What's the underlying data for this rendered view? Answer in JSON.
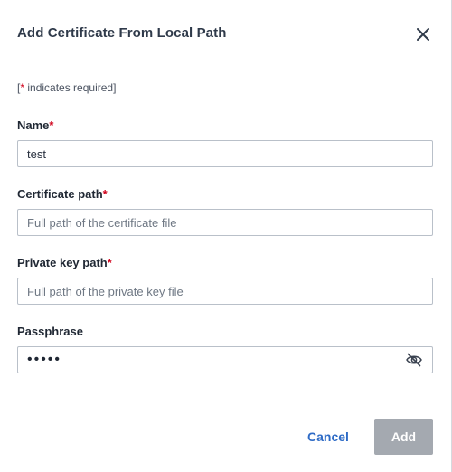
{
  "dialog": {
    "title": "Add Certificate From Local Path",
    "close_icon": "close-icon",
    "required_note_prefix": "[",
    "required_note_star": "*",
    "required_note_suffix": " indicates required]"
  },
  "fields": {
    "name": {
      "label": "Name",
      "required_mark": "*",
      "value": "test",
      "placeholder": ""
    },
    "certificate_path": {
      "label": "Certificate path",
      "required_mark": "*",
      "value": "",
      "placeholder": "Full path of the certificate file"
    },
    "private_key_path": {
      "label": "Private key path",
      "required_mark": "*",
      "value": "",
      "placeholder": "Full path of the private key file"
    },
    "passphrase": {
      "label": "Passphrase",
      "value": "12345",
      "toggle_icon": "eye-slash-icon"
    }
  },
  "actions": {
    "cancel_label": "Cancel",
    "add_label": "Add"
  },
  "colors": {
    "required": "#d0021b",
    "link": "#2e6bc6",
    "disabled_button": "#a4a9b0"
  }
}
